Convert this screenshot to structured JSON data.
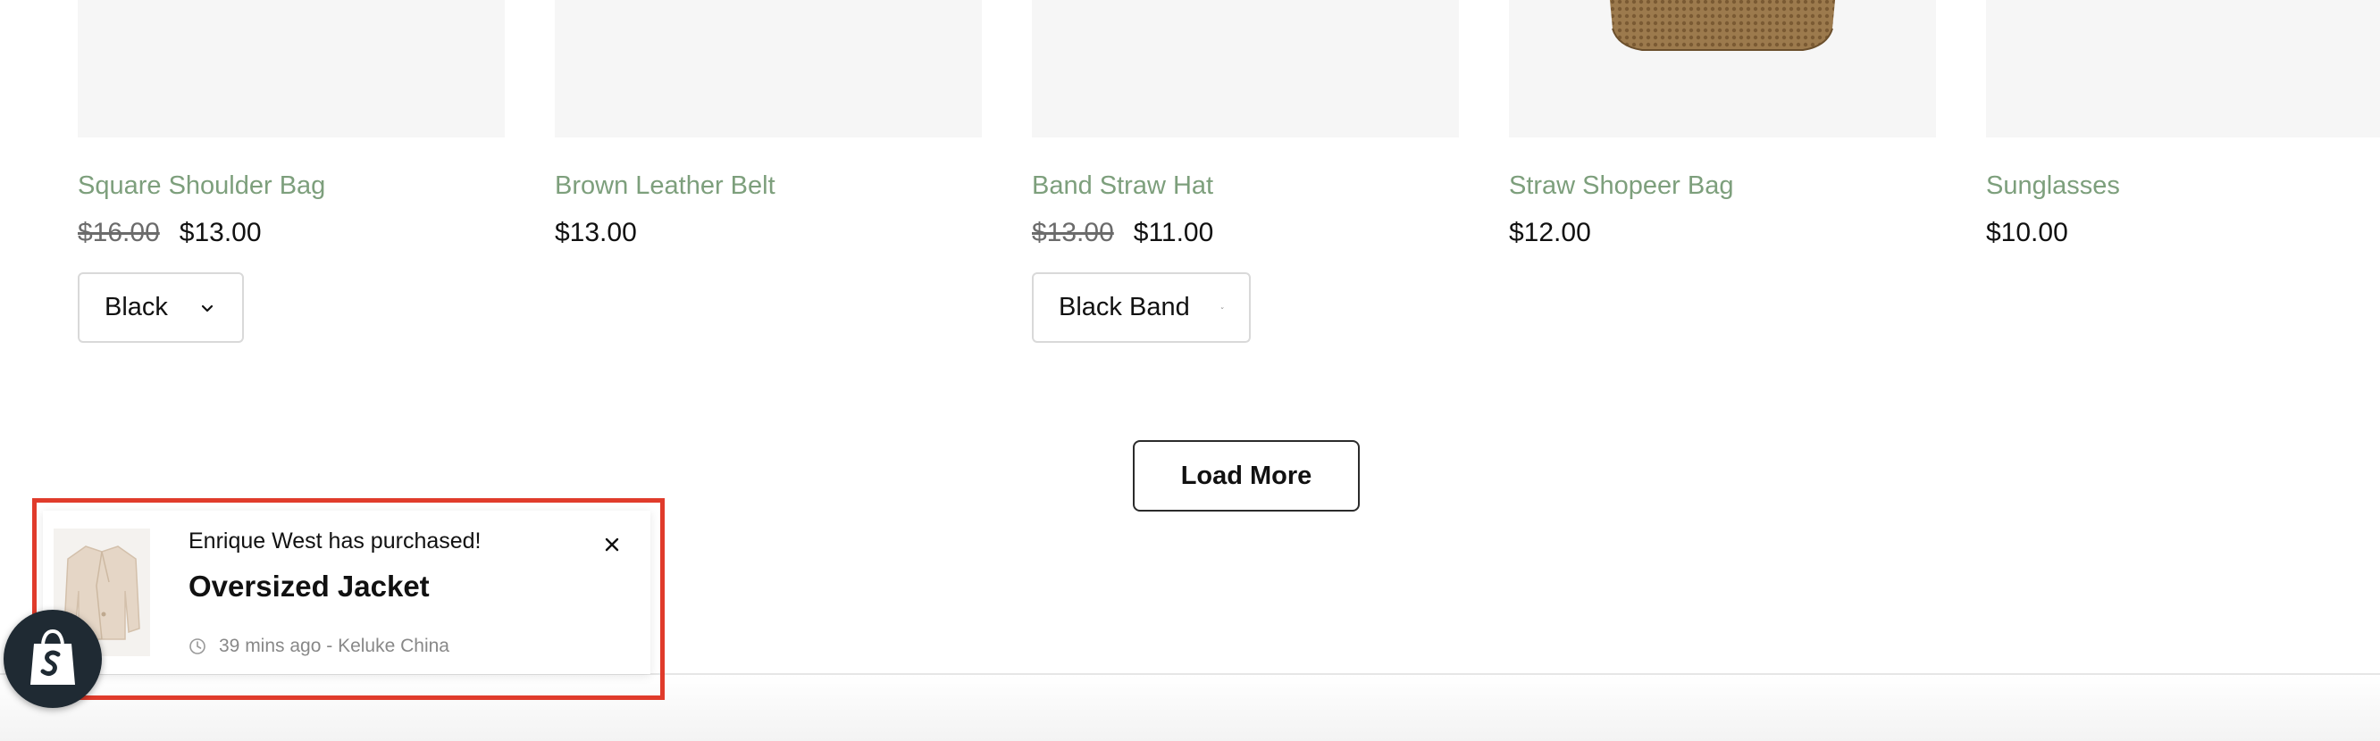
{
  "products": [
    {
      "title": "Square Shoulder Bag",
      "compare_price": "$16.00",
      "price": "$13.00",
      "variant": "Black"
    },
    {
      "title": "Brown Leather Belt",
      "compare_price": "",
      "price": "$13.00",
      "variant": ""
    },
    {
      "title": "Band Straw Hat",
      "compare_price": "$13.00",
      "price": "$11.00",
      "variant": "Black Band"
    },
    {
      "title": "Straw Shopeer Bag",
      "compare_price": "",
      "price": "$12.00",
      "variant": ""
    },
    {
      "title": "Sunglasses",
      "compare_price": "",
      "price": "$10.00",
      "variant": ""
    }
  ],
  "load_more_label": "Load More",
  "popup": {
    "buyer_text": "Enrique West has purchased!",
    "product_name": "Oversized Jacket",
    "meta_text": "39 mins ago - Keluke China"
  },
  "colors": {
    "title_green": "#7d9f7c",
    "highlight_red": "#e03b2b",
    "badge_dark": "#1f2a33"
  }
}
